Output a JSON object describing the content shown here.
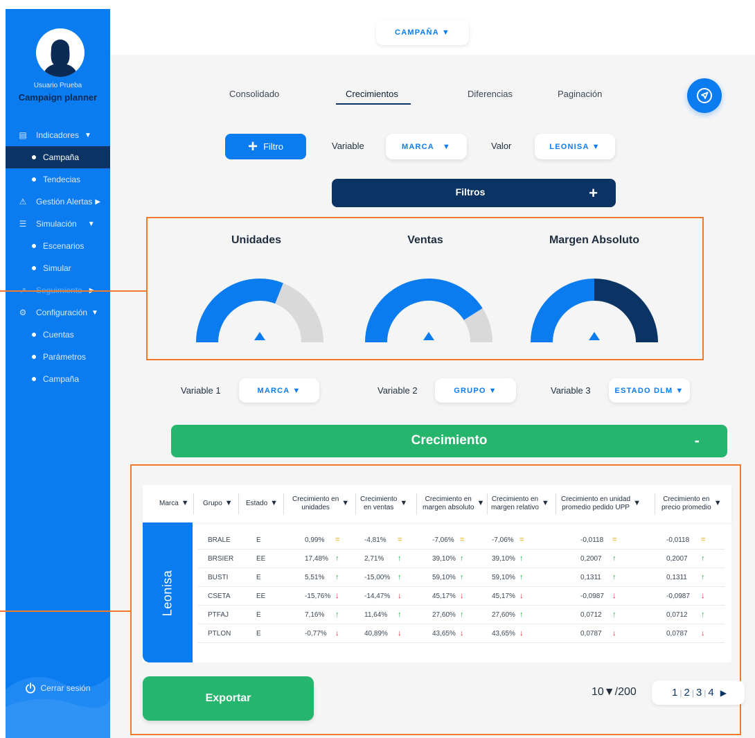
{
  "user": {
    "name": "Usuario Prueba",
    "role": "Campaign planner"
  },
  "sidebar": {
    "items": [
      {
        "label": "Indicadores",
        "icon": "grid-icon",
        "type": "main",
        "caret": "▼"
      },
      {
        "label": "Campaña",
        "type": "sub",
        "active": true
      },
      {
        "label": "Tendecias",
        "type": "sub"
      },
      {
        "label": "Gestión Alertas",
        "icon": "warning-icon",
        "type": "main",
        "caret": "▶"
      },
      {
        "label": "Simulación",
        "icon": "sliders-icon",
        "type": "main",
        "caret": "▼"
      },
      {
        "label": "Escenarios",
        "type": "sub"
      },
      {
        "label": "Simular",
        "type": "sub"
      },
      {
        "label": "Seguimiento",
        "icon": "chart-icon",
        "type": "main",
        "caret": "▶",
        "dim": true
      },
      {
        "label": "Configuración",
        "icon": "gear-icon",
        "type": "main",
        "caret": "▼"
      },
      {
        "label": "Cuentas",
        "type": "sub"
      },
      {
        "label": "Parámetros",
        "type": "sub"
      },
      {
        "label": "Campaña",
        "type": "sub"
      }
    ],
    "logout": "Cerrar sesión"
  },
  "topbar": {
    "campaign": "CAMPAÑA"
  },
  "tabs": [
    "Consolidado",
    "Crecimientos",
    "Diferencias",
    "Paginación"
  ],
  "filter": {
    "button": "Filtro",
    "variable_label": "Variable",
    "variable_value": "MARCA",
    "value_label": "Valor",
    "value_value": "LEONISA",
    "bar_label": "Filtros",
    "bar_plus": "+"
  },
  "gauges": [
    {
      "title": "Unidades",
      "fraction": 0.62,
      "fill": "#0b7cf0",
      "rest": "#d9d9d9"
    },
    {
      "title": "Ventas",
      "fraction": 0.82,
      "fill": "#0b7cf0",
      "rest": "#d9d9d9"
    },
    {
      "title": "Margen Absoluto",
      "fraction": 0.5,
      "fill": "#0b7cf0",
      "rest": "#0b3363"
    }
  ],
  "variables": {
    "v1_label": "Variable 1",
    "v1_value": "MARCA",
    "v2_label": "Variable 2",
    "v2_value": "GRUPO",
    "v3_label": "Variable 3",
    "v3_value": "ESTADO DLM"
  },
  "growth": {
    "title": "Crecimiento",
    "minus": "-"
  },
  "table": {
    "brand": "Leonisa",
    "headers": [
      {
        "label": "Marca"
      },
      {
        "label": "Grupo"
      },
      {
        "label": "Estado"
      },
      {
        "label": "Crecimiento en\nunidades"
      },
      {
        "label": "Crecimiento\nen ventas"
      },
      {
        "label": "Crecimiento en\nmargen absoluto"
      },
      {
        "label": "Crecimiento en\nmargen relativo"
      },
      {
        "label": "Crecimiento en unidad\npromedio pedido UPP"
      },
      {
        "label": "Crecimiento en\nprecio promedio"
      }
    ],
    "rows": [
      {
        "grupo": "BRALE",
        "estado": "E",
        "c1": "0,99%",
        "a1": "flat",
        "c2": "-4,81%",
        "a2": "flat",
        "c3": "-7,06%",
        "a3": "flat",
        "c4": "-7,06%",
        "a4": "flat",
        "c5": "-0,0118",
        "a5": "flat",
        "c6": "-0,0118",
        "a6": "flat"
      },
      {
        "grupo": "BRSIER",
        "estado": "EE",
        "c1": "17,48%",
        "a1": "up",
        "c2": "2,71%",
        "a2": "up",
        "c3": "39,10%",
        "a3": "up",
        "c4": "39,10%",
        "a4": "up",
        "c5": "0,2007",
        "a5": "up",
        "c6": "0,2007",
        "a6": "up"
      },
      {
        "grupo": "BUSTI",
        "estado": "E",
        "c1": "5,51%",
        "a1": "up",
        "c2": "-15,00%",
        "a2": "up",
        "c3": "59,10%",
        "a3": "up",
        "c4": "59,10%",
        "a4": "up",
        "c5": "0,1311",
        "a5": "up",
        "c6": "0,1311",
        "a6": "up"
      },
      {
        "grupo": "CSETA",
        "estado": "EE",
        "c1": "-15,76%",
        "a1": "down",
        "c2": "-14,47%",
        "a2": "down",
        "c3": "45,17%",
        "a3": "down",
        "c4": "45,17%",
        "a4": "down",
        "c5": "-0,0987",
        "a5": "down",
        "c6": "-0,0987",
        "a6": "down"
      },
      {
        "grupo": "PTFAJ",
        "estado": "E",
        "c1": "7,16%",
        "a1": "up",
        "c2": "11,64%",
        "a2": "up",
        "c3": "27,60%",
        "a3": "up",
        "c4": "27,60%",
        "a4": "up",
        "c5": "0,0712",
        "a5": "up",
        "c6": "0,0712",
        "a6": "up"
      },
      {
        "grupo": "PTLON",
        "estado": "E",
        "c1": "-0,77%",
        "a1": "down",
        "c2": "40,89%",
        "a2": "down",
        "c3": "43,65%",
        "a3": "down",
        "c4": "43,65%",
        "a4": "down",
        "c5": "0,0787",
        "a5": "down",
        "c6": "0,0787",
        "a6": "down"
      }
    ]
  },
  "footer": {
    "export": "Exportar",
    "page_size": "10",
    "total": "/200",
    "pages": [
      "1",
      "2",
      "3",
      "4"
    ]
  },
  "colors": {
    "primary": "#0b7cf0",
    "navy": "#0b3363",
    "green": "#26b56d",
    "highlight": "#f07a2a"
  }
}
